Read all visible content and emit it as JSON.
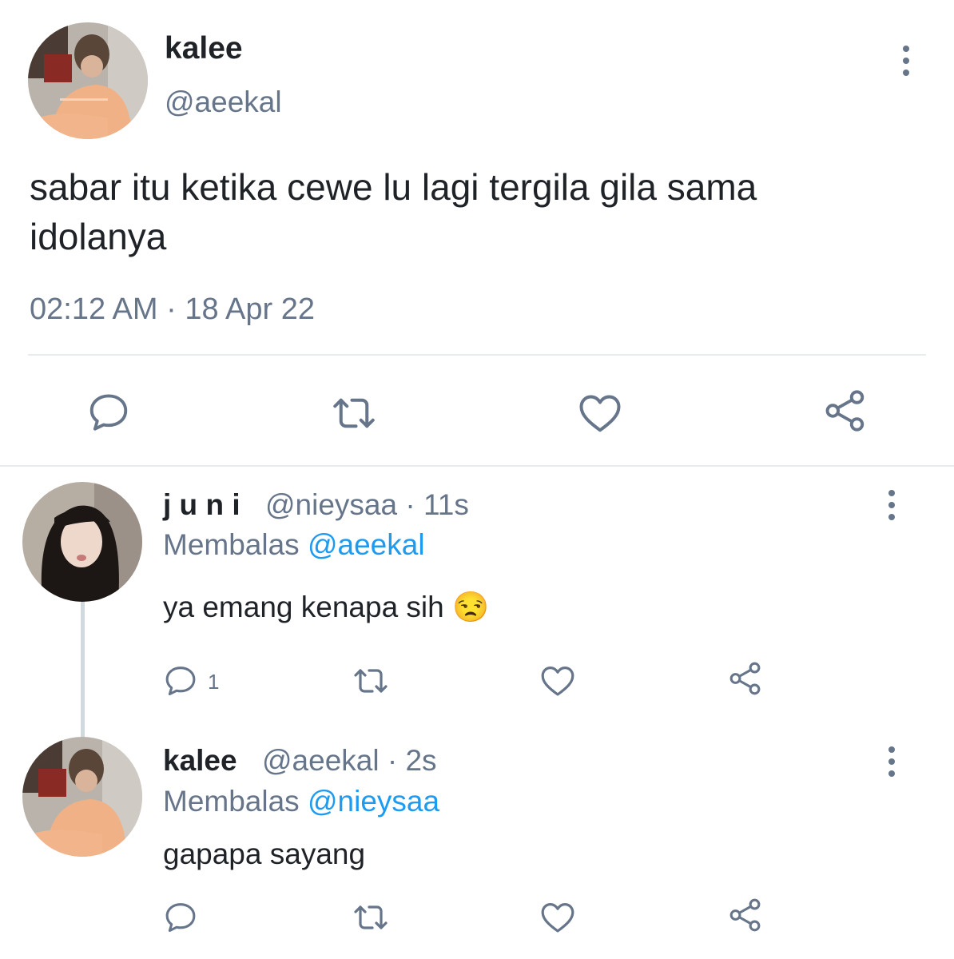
{
  "main_tweet": {
    "author_name": "kalee",
    "handle": "@aeekal",
    "text": "sabar itu ketika cewe lu lagi tergila gila sama idolanya",
    "timestamp": "02:12 AM · 18 Apr 22"
  },
  "replies": [
    {
      "author_name": "j u n i",
      "handle_time": "@nieysaa · 11s",
      "replying_prefix": "Membalas",
      "replying_to": "@aeekal",
      "text": "ya emang kenapa sih",
      "emoji": "😒",
      "reply_count": "1"
    },
    {
      "author_name": "kalee",
      "handle_time": "@aeekal · 2s",
      "replying_prefix": "Membalas",
      "replying_to": "@nieysaa",
      "text": "gapapa sayang"
    }
  ],
  "colors": {
    "muted": "#66758a",
    "link": "#1d9bf0",
    "divider": "#e6ecf0"
  },
  "icons": [
    "reply-icon",
    "retweet-icon",
    "like-icon",
    "share-icon",
    "more-options-icon"
  ]
}
